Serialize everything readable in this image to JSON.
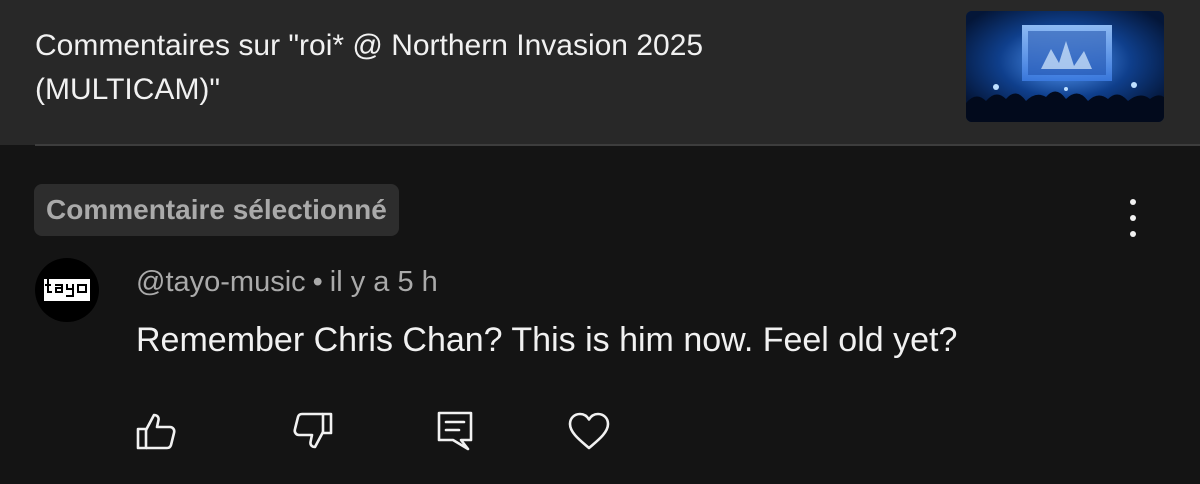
{
  "header": {
    "title": "Commentaires sur \"roi* @ Northern Invasion 2025 (MULTICAM)\"",
    "thumbnail_icon": "concert-video-thumbnail"
  },
  "badge": {
    "label": "Commentaire sélectionné"
  },
  "comment": {
    "author": "@tayo-music",
    "separator": "•",
    "time": "il y a 5 h",
    "text": "Remember Chris Chan? This is him now. Feel old yet?",
    "avatar_logo_text": "tayo"
  },
  "actions": [
    {
      "name": "like",
      "icon": "thumbs-up-icon"
    },
    {
      "name": "dislike",
      "icon": "thumbs-down-icon"
    },
    {
      "name": "reply",
      "icon": "reply-comment-icon"
    },
    {
      "name": "heart",
      "icon": "heart-icon"
    }
  ],
  "colors": {
    "background": "#141414",
    "header_background": "#282828",
    "primary_text": "#f1f1f1",
    "secondary_text": "#aaaaaa",
    "badge_background": "#2d2d2d"
  }
}
